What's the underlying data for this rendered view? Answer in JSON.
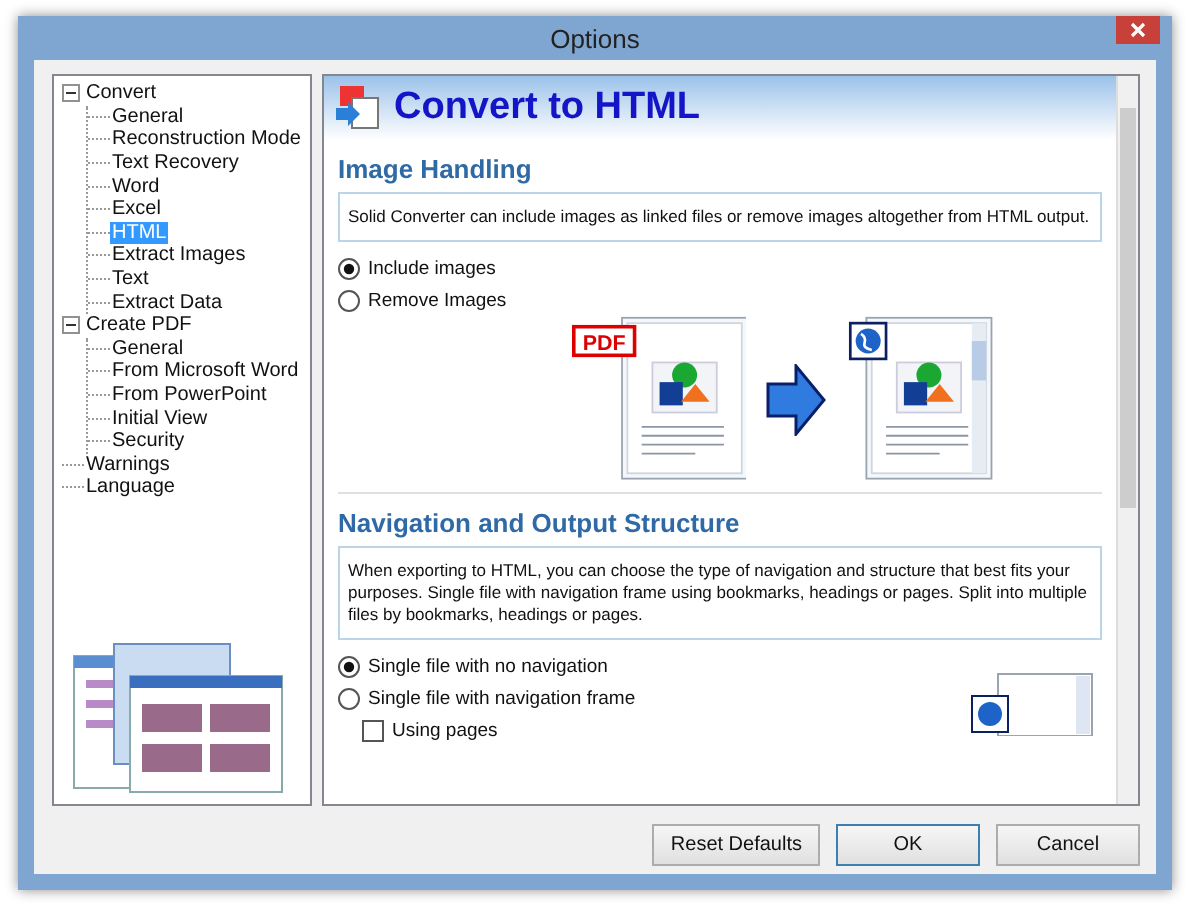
{
  "window": {
    "title": "Options"
  },
  "tree": [
    {
      "label": "Convert",
      "expanded": true,
      "selected": false,
      "children": [
        {
          "label": "General",
          "selected": false
        },
        {
          "label": "Reconstruction Mode",
          "selected": false
        },
        {
          "label": "Text Recovery",
          "selected": false
        },
        {
          "label": "Word",
          "selected": false
        },
        {
          "label": "Excel",
          "selected": false
        },
        {
          "label": "HTML",
          "selected": true
        },
        {
          "label": "Extract Images",
          "selected": false
        },
        {
          "label": "Text",
          "selected": false
        },
        {
          "label": "Extract Data",
          "selected": false
        }
      ]
    },
    {
      "label": "Create PDF",
      "expanded": true,
      "selected": false,
      "children": [
        {
          "label": "General",
          "selected": false
        },
        {
          "label": "From Microsoft Word",
          "selected": false
        },
        {
          "label": "From PowerPoint",
          "selected": false
        },
        {
          "label": "Initial View",
          "selected": false
        },
        {
          "label": "Security",
          "selected": false
        }
      ]
    },
    {
      "label": "Warnings",
      "selected": false
    },
    {
      "label": "Language",
      "selected": false
    }
  ],
  "page": {
    "title": "Convert to HTML",
    "sections": [
      {
        "heading": "Image Handling",
        "source_badge": "PDF",
        "description": "Solid Converter can include images as linked files or remove images altogether from HTML output.",
        "options": [
          {
            "kind": "radio",
            "label": "Include images",
            "selected": true
          },
          {
            "kind": "radio",
            "label": "Remove Images",
            "selected": false
          }
        ]
      },
      {
        "heading": "Navigation and Output Structure",
        "description": "When exporting to HTML, you can choose the type of navigation and structure that best fits your purposes. Single file with navigation frame using bookmarks, headings or pages. Split into multiple files by bookmarks, headings or pages.",
        "options": [
          {
            "kind": "radio",
            "label": "Single file with no navigation",
            "selected": true
          },
          {
            "kind": "radio",
            "label": "Single file with navigation frame",
            "selected": false
          },
          {
            "kind": "checkbox",
            "label": "Using pages",
            "checked": false
          }
        ]
      }
    ]
  },
  "buttons": [
    "Reset Defaults",
    "OK",
    "Cancel"
  ]
}
